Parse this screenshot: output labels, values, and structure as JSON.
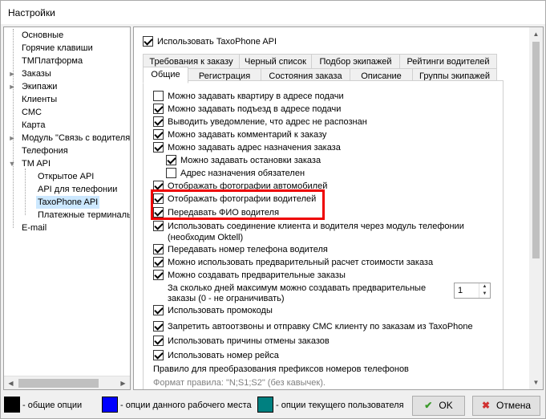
{
  "window": {
    "title": "Настройки"
  },
  "tree": {
    "items": [
      {
        "label": "Основные"
      },
      {
        "label": "Горячие клавиши"
      },
      {
        "label": "ТМПлатформа"
      },
      {
        "label": "Заказы"
      },
      {
        "label": "Экипажи"
      },
      {
        "label": "Клиенты"
      },
      {
        "label": "СМС"
      },
      {
        "label": "Карта"
      },
      {
        "label": "Модуль \"Связь с водителя"
      },
      {
        "label": "Телефония"
      },
      {
        "label": "TM API"
      },
      {
        "label": "Открытое API"
      },
      {
        "label": "API для телефонии"
      },
      {
        "label": "TaxoPhone API"
      },
      {
        "label": "Платежные терминалы"
      },
      {
        "label": "E-mail"
      }
    ]
  },
  "main": {
    "use_api_label": "Использовать TaxoPhone API",
    "tabs_row1": [
      "Требования к заказу",
      "Черный список",
      "Подбор экипажей",
      "Рейтинги водителей"
    ],
    "tabs_row2": [
      "Общие",
      "Регистрация",
      "Состояния заказа",
      "Описание",
      "Группы экипажей"
    ],
    "options": [
      {
        "label": "Можно задавать квартиру в адресе подачи",
        "checked": false
      },
      {
        "label": "Можно задавать подъезд в адресе подачи",
        "checked": true
      },
      {
        "label": "Выводить уведомление, что адрес не распознан",
        "checked": true
      },
      {
        "label": "Можно задавать комментарий к заказу",
        "checked": true
      },
      {
        "label": "Можно задавать адрес назначения заказа",
        "checked": true
      },
      {
        "label": "Можно задавать остановки заказа",
        "checked": true
      },
      {
        "label": "Адрес назначения обязателен",
        "checked": false
      },
      {
        "label": "Отображать фотографии автомобилей",
        "checked": true
      },
      {
        "label": "Отображать фотографии водителей",
        "checked": true
      },
      {
        "label": "Передавать ФИО водителя",
        "checked": true
      },
      {
        "label": "Использовать соединение клиента и водителя через модуль телефонии",
        "checked": true
      },
      {
        "label": "Передавать номер телефона водителя",
        "checked": true
      },
      {
        "label": "Можно использовать предварительный расчет стоимости заказа",
        "checked": true
      },
      {
        "label": "Можно создавать предварительные заказы",
        "checked": true
      },
      {
        "label": "Использовать промокоды",
        "checked": true
      },
      {
        "label": "Запретить автоотзвоны и отправку СМС клиенту по заказам из TaxoPhone",
        "checked": true
      },
      {
        "label": "Использовать причины отмены заказов",
        "checked": true
      },
      {
        "label": "Использовать номер рейса",
        "checked": true
      }
    ],
    "telephony_note": "(необходим Oktell)",
    "prebook_days_label_1": "За сколько дней максимум можно создавать предварительные",
    "prebook_days_label_2": "заказы (0 - не ограничивать)",
    "prebook_days_value": "1",
    "prefix_rules_label": "Правило для преобразования префиксов номеров телефонов",
    "format_rule_label": "Формат правила: \"N;S1;S2\" (без кавычек)."
  },
  "footer": {
    "legend": [
      {
        "color": "#000000",
        "label": "- общие опции"
      },
      {
        "color": "#0000ff",
        "label": "- опции данного рабочего места"
      },
      {
        "color": "#008080",
        "label": "- опции текущего пользователя"
      }
    ],
    "ok_label": "OK",
    "cancel_label": "Отмена"
  }
}
